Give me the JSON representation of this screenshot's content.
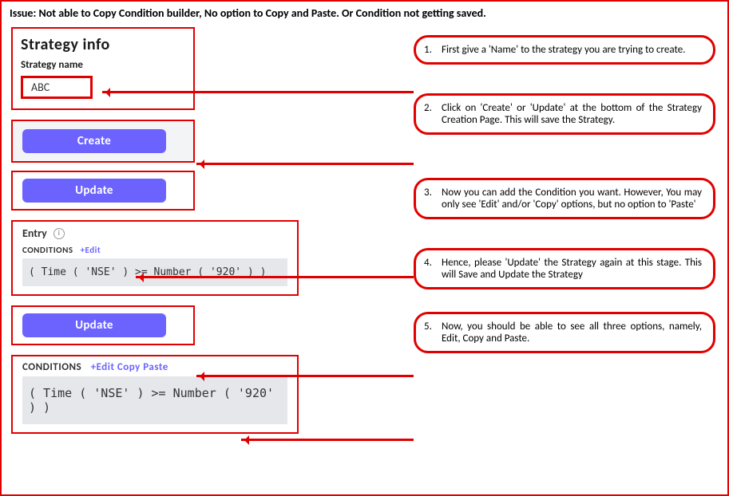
{
  "issue_title": "Issue: Not able to Copy Condition builder, No option to Copy and Paste. Or Condition not getting saved.",
  "strategy_info": {
    "heading": "Strategy info",
    "name_label": "Strategy name",
    "name_value": "ABC"
  },
  "buttons": {
    "create": "Create",
    "update1": "Update",
    "update2": "Update"
  },
  "entry_panel": {
    "title": "Entry",
    "info_icon": "i",
    "conditions_label": "CONDITIONS",
    "edit_link": "+Edit",
    "expression": "( Time ( 'NSE' ) >= Number ( '920' )  )"
  },
  "conditions_final": {
    "label": "CONDITIONS",
    "links": "+Edit Copy Paste",
    "expression": "( Time ( 'NSE' ) >= Number ( '920' )  )"
  },
  "instructions": [
    {
      "num": "1.",
      "text": "First give a 'Name' to the strategy you are trying to create."
    },
    {
      "num": "2.",
      "text": "Click on 'Create' or 'Update' at the bottom of the Strategy Creation Page. This will save the Strategy."
    },
    {
      "num": "3.",
      "text": "Now you can add the Condition you want. However, You may only see 'Edit' and/or  'Copy' options, but no option to 'Paste'"
    },
    {
      "num": "4.",
      "text": "Hence, please 'Update' the Strategy again at this stage. This will Save and Update the Strategy"
    },
    {
      "num": "5.",
      "text": "Now, you should be able to see all three options, namely, Edit, Copy and Paste."
    }
  ]
}
